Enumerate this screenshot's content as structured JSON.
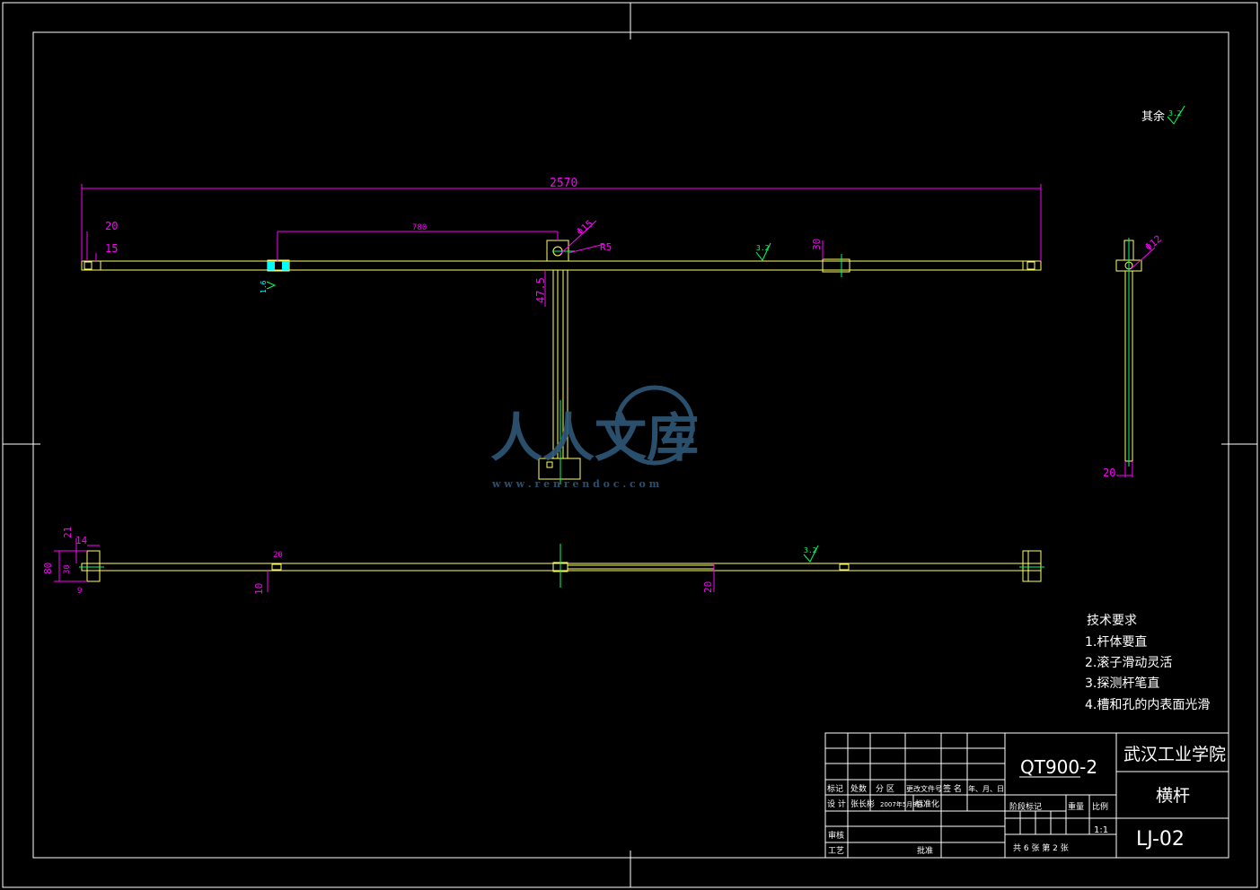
{
  "colors": {
    "background": "#000000",
    "frame": "#ffffff",
    "part": "#ffff66",
    "dimension": "#ff00ff",
    "centerline": "#00ff66",
    "roughness": "#00ff66",
    "watermark": "#2f5878"
  },
  "roughness_note": {
    "label": "其余",
    "value": "3.2"
  },
  "front_view": {
    "overall_length": "2570",
    "left_offset_20": "20",
    "left_offset_15": "15",
    "span_780": "780",
    "hole_dia": "Φ15",
    "radius": "R5",
    "right_width": "30",
    "roughness_mid": "3.2",
    "roughness_left": "1.6",
    "stem_height": "47.5"
  },
  "side_view": {
    "hole_dia": "Φ12",
    "bottom_width": "20"
  },
  "bottom_view": {
    "dim_80": "80",
    "dim_21": "21",
    "dim_14": "14",
    "dim_30": "30",
    "dim_9": "9",
    "dim_20_left": "20",
    "dim_10": "10",
    "dim_20_mid": "20",
    "roughness": "3.2"
  },
  "tech_requirements": {
    "title": "技术要求",
    "items": [
      "1.杆体要直",
      "2.滚子滑动灵活",
      "3.探测杆笔直",
      "4.槽和孔的内表面光滑"
    ]
  },
  "title_block": {
    "material": "QT900-2",
    "school": "武汉工业学院",
    "part_name": "横杆",
    "drawing_no": "LJ-02",
    "scale": "1:1",
    "headers": [
      "标记",
      "处数",
      "分 区",
      "更改文件号",
      "签 名",
      "年、月、日"
    ],
    "design_label": "设 计",
    "designer": "张长彬",
    "date": "2007年5月8日",
    "standard_label": "标准化",
    "review_label": "审核",
    "process_label": "工艺",
    "approve_label": "批准",
    "stage_label": "阶段标记",
    "weight_label": "重量",
    "ratio_label": "比例",
    "sheet_info": "共 6 张  第 2 张"
  },
  "watermark": {
    "text": "人人文库",
    "url": "w w w . r e n r e n d o c . c o m"
  }
}
